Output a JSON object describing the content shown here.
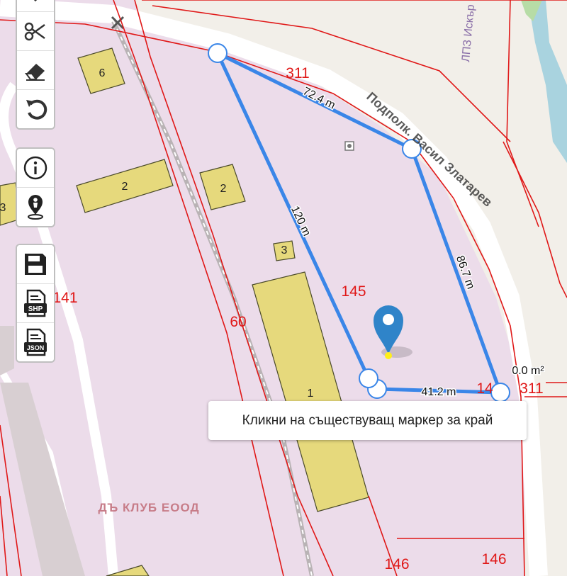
{
  "map": {
    "road_labels": [
      "Подполк. Васил Златарев",
      "ЛПЗ Искър"
    ],
    "company_label": "ДЪ КЛУБ ЕООД",
    "parcel_labels": [
      "311",
      "145",
      "141",
      "60",
      "146",
      "146",
      "311",
      "14"
    ],
    "building_labels": [
      "6",
      "2",
      "2",
      "3",
      "3",
      "1"
    ],
    "measurements": {
      "segments": [
        "72.4 m",
        "120 m",
        "86.7 m",
        "41.2 m"
      ],
      "area": "0.0 m²"
    },
    "colors": {
      "land": "#ecdcea",
      "building": "#e6d97c",
      "parcel_line": "#e01818",
      "measure_line": "#3a86e8",
      "river": "#a9d3df",
      "road": "#ffffff"
    }
  },
  "toolbar": {
    "edit_icons": [
      "cut-icon",
      "eraser-icon",
      "undo-icon"
    ],
    "info_icons": [
      "info-icon",
      "location-pin-icon"
    ],
    "export_icons": [
      "save-icon",
      "shp-file-icon",
      "json-file-icon"
    ],
    "shp_label": "SHP",
    "json_label": "JSON"
  },
  "tooltip": {
    "text": "Кликни на съществуващ маркер за край"
  }
}
